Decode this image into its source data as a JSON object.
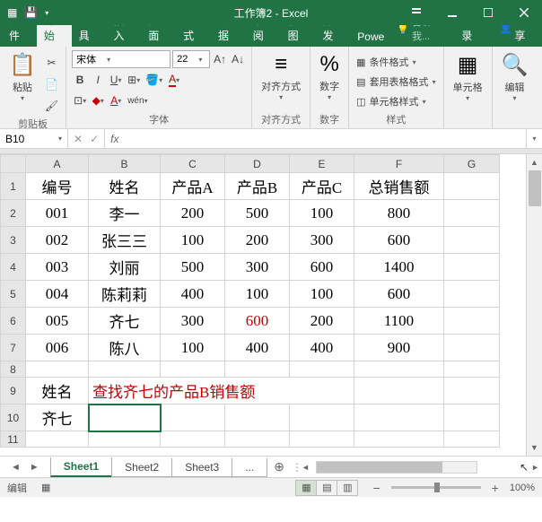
{
  "titlebar": {
    "title": "工作簿2 - Excel"
  },
  "ribbon_tabs": {
    "items": [
      "文件",
      "开始",
      "工具",
      "插入",
      "页面",
      "公式",
      "数据",
      "审阅",
      "视图",
      "开发",
      "Powe"
    ],
    "active_index": 1,
    "tell_me": "告诉我...",
    "login": "登录",
    "share": "共享"
  },
  "ribbon": {
    "clipboard": {
      "paste": "粘贴",
      "label": "剪贴板"
    },
    "font": {
      "name": "宋体",
      "size": "22",
      "label": "字体"
    },
    "alignment": {
      "btn": "对齐方式",
      "label": "对齐方式"
    },
    "number": {
      "btn": "数字",
      "pct": "%",
      "label": "数字"
    },
    "styles": {
      "cond": "条件格式",
      "table": "套用表格格式",
      "cell": "单元格样式",
      "label": "样式"
    },
    "cells": {
      "btn": "单元格"
    },
    "editing": {
      "btn": "编辑"
    }
  },
  "namebox": {
    "ref": "B10",
    "fx": "fx",
    "formula": ""
  },
  "chart_data": {
    "type": "table",
    "columns": [
      "编号",
      "姓名",
      "产品A",
      "产品B",
      "产品C",
      "总销售额"
    ],
    "rows": [
      [
        "001",
        "李一",
        200,
        500,
        100,
        800
      ],
      [
        "002",
        "张三三",
        100,
        200,
        300,
        600
      ],
      [
        "003",
        "刘丽",
        500,
        300,
        600,
        1400
      ],
      [
        "004",
        "陈莉莉",
        400,
        100,
        100,
        600
      ],
      [
        "005",
        "齐七",
        300,
        600,
        200,
        1100
      ],
      [
        "006",
        "陈八",
        100,
        400,
        400,
        900
      ]
    ],
    "highlight": {
      "row": 4,
      "col": 3
    }
  },
  "grid": {
    "col_headers": [
      "A",
      "B",
      "C",
      "D",
      "E",
      "F",
      "G"
    ],
    "row_headers": [
      "1",
      "2",
      "3",
      "4",
      "5",
      "6",
      "7",
      "8",
      "9",
      "10",
      "11"
    ],
    "r1": {
      "A": "编号",
      "B": "姓名",
      "C": "产品A",
      "D": "产品B",
      "E": "产品C",
      "F": "总销售额"
    },
    "r2": {
      "A": "001",
      "B": "李一",
      "C": "200",
      "D": "500",
      "E": "100",
      "F": "800"
    },
    "r3": {
      "A": "002",
      "B": "张三三",
      "C": "100",
      "D": "200",
      "E": "300",
      "F": "600"
    },
    "r4": {
      "A": "003",
      "B": "刘丽",
      "C": "500",
      "D": "300",
      "E": "600",
      "F": "1400"
    },
    "r5": {
      "A": "004",
      "B": "陈莉莉",
      "C": "400",
      "D": "100",
      "E": "100",
      "F": "600"
    },
    "r6": {
      "A": "005",
      "B": "齐七",
      "C": "300",
      "D": "600",
      "E": "200",
      "F": "1100"
    },
    "r7": {
      "A": "006",
      "B": "陈八",
      "C": "100",
      "D": "400",
      "E": "400",
      "F": "900"
    },
    "r9": {
      "A": "姓名",
      "B": "查找齐七的产品B销售额"
    },
    "r10": {
      "A": "齐七"
    }
  },
  "sheets": {
    "items": [
      "Sheet1",
      "Sheet2",
      "Sheet3"
    ],
    "active_index": 0
  },
  "status": {
    "mode": "编辑",
    "zoom": "100%"
  }
}
